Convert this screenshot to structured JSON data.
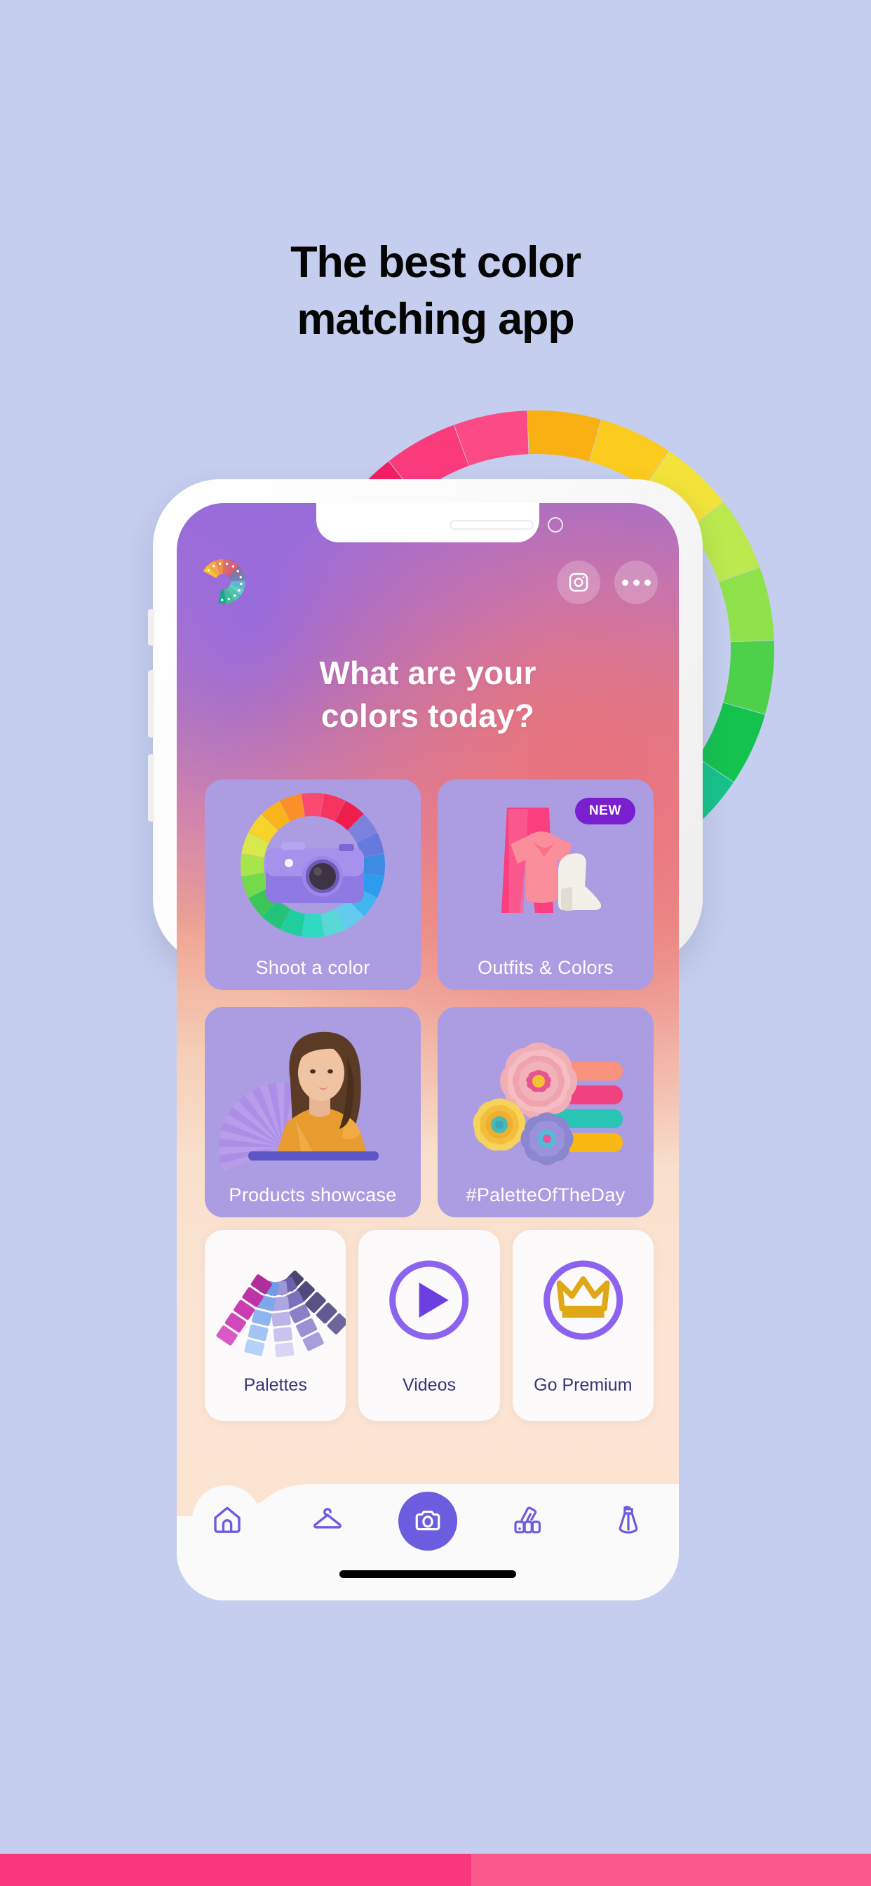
{
  "page": {
    "background_color": "#C5CEEE",
    "headline_line1": "The best color",
    "headline_line2": "matching app"
  },
  "wheel": {
    "name": "color-wheel-ring",
    "segments": [
      "#E3104E",
      "#F31F63",
      "#FB3A7C",
      "#FB4A85",
      "#F9B012",
      "#FBCB1E",
      "#F2E23A",
      "#BCE94D",
      "#8FE24A",
      "#4DD14A",
      "#14C24E",
      "#17C38A",
      "#18BDB6"
    ]
  },
  "phone": {
    "status_bar": {
      "speaker": "speaker-pill",
      "camera": "front-camera-dot"
    },
    "header": {
      "logo": "color-fan-logo",
      "instagram_label": "instagram-icon",
      "more_label": "more-options-icon"
    },
    "title_line1": "What are your",
    "title_line2": "colors today?",
    "big_cards": [
      {
        "id": "shoot-a-color",
        "label": "Shoot a color",
        "art": "color-wheel-camera",
        "badge": null
      },
      {
        "id": "outfits-and-colors",
        "label": "Outfits & Colors",
        "art": "outfit-pants-top-boot",
        "badge": "NEW"
      },
      {
        "id": "products-showcase",
        "label": "Products showcase",
        "art": "model-orange-dress-fan",
        "badge": null
      },
      {
        "id": "palette-of-the-day",
        "label": "#PaletteOfTheDay",
        "art": "paper-flowers-palette",
        "badge": null
      }
    ],
    "small_cards": [
      {
        "id": "palettes",
        "label": "Palettes",
        "art": "swatch-fan-icon"
      },
      {
        "id": "videos",
        "label": "Videos",
        "art": "play-circle-icon"
      },
      {
        "id": "go-premium",
        "label": "Go Premium",
        "art": "crown-circle-icon"
      }
    ],
    "nav": [
      {
        "id": "home",
        "icon": "home-icon",
        "active": true
      },
      {
        "id": "wardrobe",
        "icon": "hanger-icon",
        "active": false
      },
      {
        "id": "camera",
        "icon": "camera-icon",
        "active": false
      },
      {
        "id": "palettes",
        "icon": "swatches-icon",
        "active": false
      },
      {
        "id": "dress",
        "icon": "dress-icon",
        "active": false
      }
    ]
  },
  "colors": {
    "card_purple": "#AC9CE2",
    "accent_purple": "#6B5CE0",
    "badge_purple": "#7a1fd0",
    "small_card_bg": "#FCFAFA",
    "small_card_text": "#37357a",
    "strip_left": "#F9377E",
    "strip_right": "#FA5A8B",
    "palette_bars": [
      "#F9937D",
      "#F0427F",
      "#2AC4B4",
      "#FAB813"
    ]
  }
}
